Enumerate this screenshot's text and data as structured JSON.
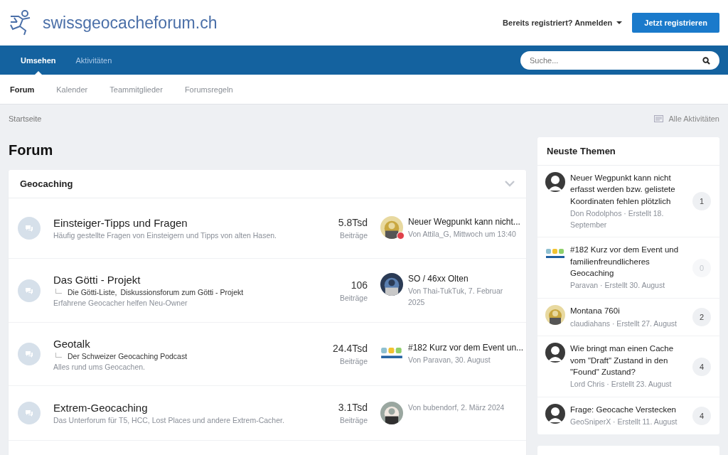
{
  "header": {
    "site_name": "swissgeocacheforum.ch",
    "sign_in": "Bereits registriert? Anmelden",
    "register": "Jetzt registrieren"
  },
  "nav": {
    "tabs": [
      {
        "label": "Umsehen",
        "selected": true
      },
      {
        "label": "Aktivitäten",
        "selected": false
      }
    ],
    "search": {
      "placeholder": "Suche..."
    }
  },
  "subnav": [
    {
      "label": "Forum",
      "selected": true
    },
    {
      "label": "Kalender",
      "selected": false
    },
    {
      "label": "Teammitglieder",
      "selected": false
    },
    {
      "label": "Forumsregeln",
      "selected": false
    }
  ],
  "breadcrumb": "Startseite",
  "all_activity": "Alle Aktivitäten",
  "page_title": "Forum",
  "category": {
    "title": "Geocaching",
    "expanded": true,
    "forums": [
      {
        "title": "Einsteiger-Tipps und Fragen",
        "description": "Häufig gestellte Fragen von Einsteigern und Tipps von alten Hasen.",
        "count": "5.8Tsd",
        "count_label": "Beiträge",
        "last_post": {
          "badge": true,
          "title": "Neuer Wegpunkt kann nicht...",
          "meta": "Von Attila_G, Mittwoch um 13:40"
        }
      },
      {
        "title": "Das Götti - Projekt",
        "subforums": [
          "Die Götti-Liste,",
          "Diskussionsforum zum Götti - Projekt"
        ],
        "description": "Erfahrene Geocacher helfen Neu-Owner",
        "count": "106",
        "count_label": "Beiträge",
        "last_post": {
          "badge": false,
          "title": "SO / 46xx Olten",
          "meta": "Von Thai-TukTuk, 7. Februar 2025"
        }
      },
      {
        "title": "Geotalk",
        "subforums": [
          "Der Schweizer Geocaching Podcast"
        ],
        "description": "Alles rund ums Geocachen.",
        "count": "24.4Tsd",
        "count_label": "Beiträge",
        "last_post": {
          "avatar": {
            "kind": "logo"
          },
          "badge": false,
          "title": "#182 Kurz vor dem Event un...",
          "meta": "Von Paravan, 30. August"
        }
      },
      {
        "title": "Extrem-Geocaching",
        "description": "Das Unterforum für T5, HCC, Lost Places und andere Extrem-Cacher.",
        "count": "3.1Tsd",
        "count_label": "Beiträge",
        "last_post": {
          "badge": false,
          "meta": "Von bubendorf, 2. März 2024"
        }
      }
    ]
  },
  "sidebar": {
    "title": "Neuste Themen",
    "topics": [
      {
        "avatar": {
          "kind": "silhouette"
        },
        "title": "Neuer Wegpunkt kann nicht erfasst werden bzw. gelistete Koordinaten fehlen plötzlich",
        "meta": "Don Rodolphos · Erstellt 18. September",
        "replies": "1",
        "muted": false
      },
      {
        "avatar": {
          "kind": "logo"
        },
        "title": "#182 Kurz vor dem Event und familienfreundlicheres Geocaching",
        "meta": "Paravan · Erstellt 30. August",
        "replies": "0",
        "muted": true
      },
      {
        "title": "Montana 760i",
        "meta": "claudiahans · Erstellt 27. August",
        "replies": "2",
        "muted": false
      },
      {
        "avatar": {
          "kind": "silhouette"
        },
        "title": "Wie bringt man einen Cache vom \"Draft\" Zustand in den \"Found\" Zustand?",
        "meta": "Lord Chris · Erstellt 23. August",
        "replies": "4",
        "muted": false
      },
      {
        "avatar": {
          "kind": "silhouette"
        },
        "title": "Frage: Geocache Verstecken",
        "meta": "GeoSniperX · Erstellt 11. August",
        "replies": "4",
        "muted": false
      }
    ]
  }
}
